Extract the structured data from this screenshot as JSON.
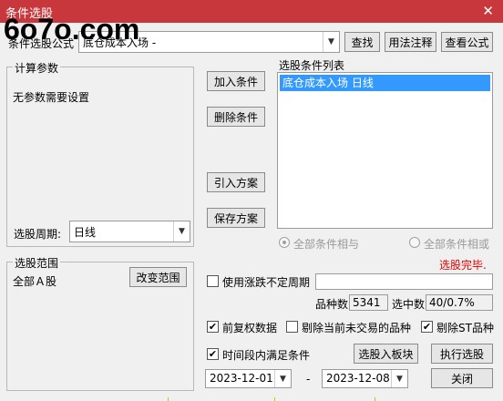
{
  "window": {
    "title": "条件选股",
    "close_glyph": "✕",
    "watermark": "6o7o.com"
  },
  "top": {
    "formula_label": "条件选股公式",
    "formula_value": "底仓成本入场 -",
    "find_button": "查找",
    "usage_button": "用法注释",
    "view_button": "查看公式"
  },
  "params": {
    "group_title": "计算参数",
    "no_params_text": "无参数需要设置",
    "period_label": "选股周期:",
    "period_value": "日线"
  },
  "range": {
    "group_title": "选股范围",
    "value": "全部Ａ股",
    "change_button": "改变范围"
  },
  "actions": {
    "add_condition": "加入条件",
    "delete_condition": "删除条件",
    "import_scheme": "引入方案",
    "save_scheme": "保存方案"
  },
  "conditions": {
    "list_title": "选股条件列表",
    "items": [
      "底仓成本入场  日线"
    ],
    "and_label": "全部条件相与",
    "or_label": "全部条件相或",
    "status": "选股完毕."
  },
  "options": {
    "unfixed_period_label": "使用涨跌不定周期",
    "unfixed_period_checked": false,
    "count_label": "品种数",
    "count_value": "5341",
    "selected_label": "选中数",
    "selected_value": "40/0.7%",
    "pre_adjust_label": "前复权数据",
    "pre_adjust_checked": true,
    "exclude_untraded_label": "剔除当前未交易的品种",
    "exclude_untraded_checked": false,
    "exclude_st_label": "剔除ST品种",
    "exclude_st_checked": true,
    "time_range_label": "时间段内满足条件",
    "time_range_checked": true,
    "to_block_button": "选股入板块",
    "execute_button": "执行选股",
    "start_date": "2023-12-01",
    "date_separator": "-",
    "end_date": "2023-12-08",
    "close_button": "关闭",
    "check_glyph": "✔"
  },
  "colors": {
    "titlebar": "#c8373b",
    "selection": "#3399ff",
    "status_red": "#e60000"
  }
}
